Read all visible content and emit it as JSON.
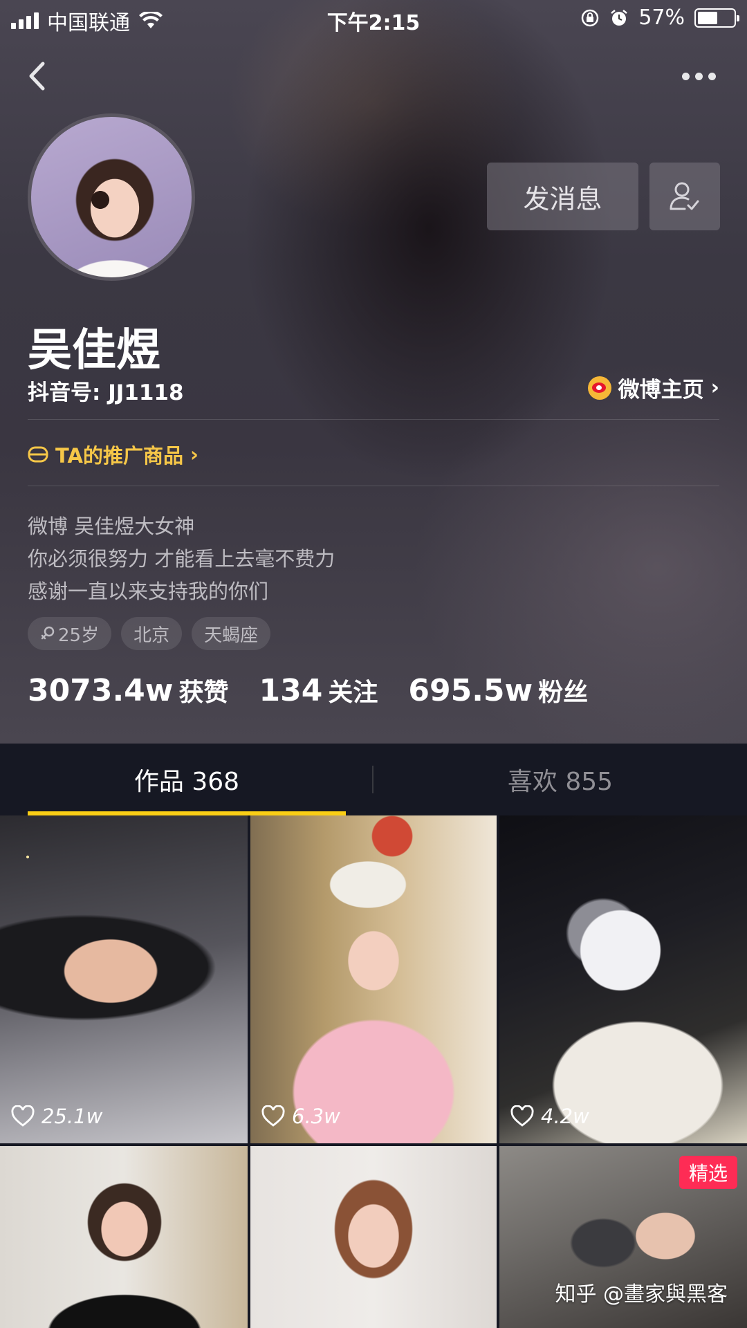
{
  "status_bar": {
    "carrier": "中国联通",
    "time": "下午2:15",
    "battery_percent": "57%",
    "battery_level": 0.57
  },
  "profile": {
    "message_button": "发消息",
    "name": "吴佳煜",
    "douyin_id": "抖音号: JJ1118",
    "weibo_link": "微博主页",
    "promo_link": "TA的推广商品",
    "bio_lines": [
      "微博  吴佳煜大女神",
      "你必须很努力 才能看上去毫不费力",
      "感谢一直以来支持我的你们"
    ],
    "tags": [
      "25岁",
      "北京",
      "天蝎座"
    ],
    "stats": [
      {
        "value": "3073.4w",
        "label": "获赞"
      },
      {
        "value": "134",
        "label": "关注"
      },
      {
        "value": "695.5w",
        "label": "粉丝"
      }
    ]
  },
  "tabs": [
    {
      "label": "作品 368",
      "active": true
    },
    {
      "label": "喜欢 855",
      "active": false
    }
  ],
  "videos": [
    {
      "likes": "25.1w"
    },
    {
      "likes": "6.3w"
    },
    {
      "likes": "4.2w"
    },
    {
      "likes": ""
    },
    {
      "likes": ""
    },
    {
      "likes": "",
      "badge": "精选"
    }
  ],
  "watermark": "知乎 @畫家與黑客",
  "colors": {
    "accent_yellow": "#face15",
    "promo_yellow": "#f6c748",
    "badge_red": "#fe2c55",
    "background": "#161823"
  },
  "icons": [
    "signal-icon",
    "wifi-icon",
    "lock-rotation-icon",
    "alarm-icon",
    "battery-icon",
    "back-icon",
    "more-icon",
    "follow-user-icon",
    "weibo-icon",
    "cart-icon",
    "female-icon",
    "heart-icon"
  ]
}
